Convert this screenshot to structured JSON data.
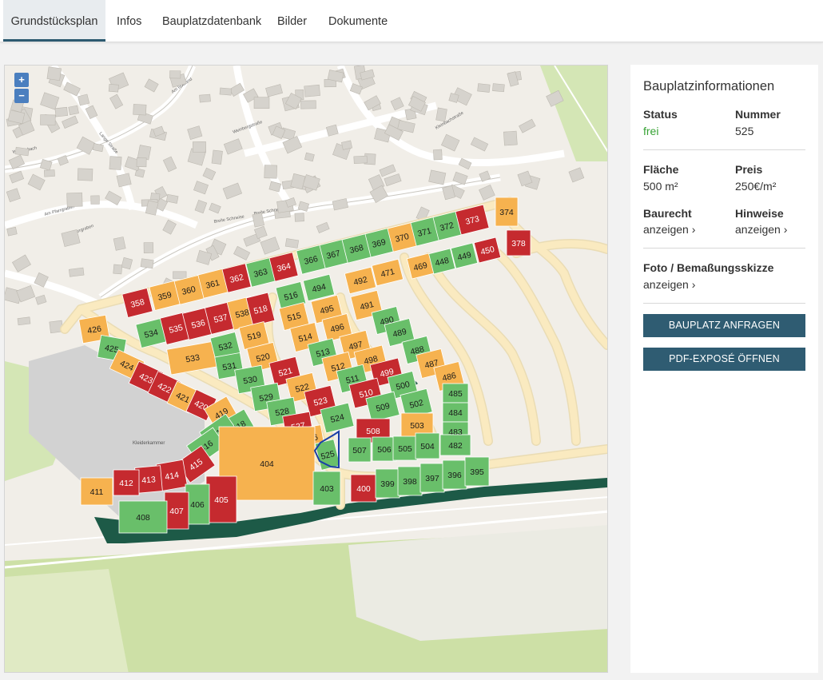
{
  "tabs": [
    {
      "label": "Grundstücksplan",
      "active": true
    },
    {
      "label": "Infos"
    },
    {
      "label": "Bauplatzdatenbank"
    },
    {
      "label": "Bilder"
    },
    {
      "label": "Dokumente"
    }
  ],
  "map": {
    "zoom_in": "+",
    "zoom_out": "−",
    "streets": [
      "Am Rodland",
      "Am Pfarrgraben",
      "Am Pfarrgraben",
      "Breite Schneise",
      "Breite Schneise",
      "Lange Straße",
      "Weißenbach",
      "Weinbergstraße",
      "Kleinbachstraße"
    ],
    "area_label": "Kleiderkammer"
  },
  "colors": {
    "free": "#69bf6a",
    "reserved": "#f6b24f",
    "sold": "#c52a2f",
    "road": "#faeac0",
    "green_strip": "#1d5a47",
    "selected_outline": "#1a3fa8"
  },
  "panel": {
    "title": "Bauplatzinformationen",
    "status_label": "Status",
    "status_value": "frei",
    "number_label": "Nummer",
    "number_value": "525",
    "area_label": "Fläche",
    "area_value": "500 m²",
    "price_label": "Preis",
    "price_value": "250€/m²",
    "baurecht_label": "Baurecht",
    "baurecht_link": "anzeigen ›",
    "hinweise_label": "Hinweise",
    "hinweise_link": "anzeigen ›",
    "foto_label": "Foto / Bemaßungsskizze",
    "foto_link": "anzeigen ›",
    "request_button": "BAUPLATZ ANFRAGEN",
    "pdf_button": "PDF-EXPOSÉ ÖFFNEN"
  },
  "plots": [
    {
      "num": "374",
      "s": "r"
    },
    {
      "num": "373",
      "s": "s"
    },
    {
      "num": "372",
      "s": "f"
    },
    {
      "num": "371",
      "s": "f"
    },
    {
      "num": "370",
      "s": "r"
    },
    {
      "num": "369",
      "s": "f"
    },
    {
      "num": "368",
      "s": "f"
    },
    {
      "num": "367",
      "s": "f"
    },
    {
      "num": "366",
      "s": "f"
    },
    {
      "num": "364",
      "s": "s"
    },
    {
      "num": "363",
      "s": "f"
    },
    {
      "num": "362",
      "s": "s"
    },
    {
      "num": "361",
      "s": "r"
    },
    {
      "num": "360",
      "s": "r"
    },
    {
      "num": "359",
      "s": "r"
    },
    {
      "num": "358",
      "s": "s"
    },
    {
      "num": "378",
      "s": "s"
    },
    {
      "num": "450",
      "s": "s"
    },
    {
      "num": "449",
      "s": "f"
    },
    {
      "num": "448",
      "s": "f"
    },
    {
      "num": "469",
      "s": "r"
    },
    {
      "num": "471",
      "s": "r"
    },
    {
      "num": "492",
      "s": "r"
    },
    {
      "num": "494",
      "s": "f"
    },
    {
      "num": "516",
      "s": "f"
    },
    {
      "num": "426",
      "s": "r"
    },
    {
      "num": "534",
      "s": "f"
    },
    {
      "num": "535",
      "s": "s"
    },
    {
      "num": "536",
      "s": "s"
    },
    {
      "num": "537",
      "s": "s"
    },
    {
      "num": "538",
      "s": "r"
    },
    {
      "num": "518",
      "s": "s"
    },
    {
      "num": "515",
      "s": "r"
    },
    {
      "num": "495",
      "s": "r"
    },
    {
      "num": "491",
      "s": "r"
    },
    {
      "num": "425",
      "s": "f"
    },
    {
      "num": "533",
      "s": "r"
    },
    {
      "num": "532",
      "s": "f"
    },
    {
      "num": "519",
      "s": "r"
    },
    {
      "num": "514",
      "s": "r"
    },
    {
      "num": "496",
      "s": "r"
    },
    {
      "num": "490",
      "s": "f"
    },
    {
      "num": "489",
      "s": "f"
    },
    {
      "num": "424",
      "s": "r"
    },
    {
      "num": "531",
      "s": "f"
    },
    {
      "num": "520",
      "s": "r"
    },
    {
      "num": "513",
      "s": "f"
    },
    {
      "num": "497",
      "s": "r"
    },
    {
      "num": "488",
      "s": "f"
    },
    {
      "num": "498",
      "s": "r"
    },
    {
      "num": "487",
      "s": "r"
    },
    {
      "num": "423",
      "s": "s"
    },
    {
      "num": "422",
      "s": "s"
    },
    {
      "num": "530",
      "s": "f"
    },
    {
      "num": "521",
      "s": "s"
    },
    {
      "num": "512",
      "s": "r"
    },
    {
      "num": "511",
      "s": "f"
    },
    {
      "num": "499",
      "s": "s"
    },
    {
      "num": "486",
      "s": "r"
    },
    {
      "num": "421",
      "s": "r"
    },
    {
      "num": "420",
      "s": "s"
    },
    {
      "num": "529",
      "s": "f"
    },
    {
      "num": "522",
      "s": "r"
    },
    {
      "num": "510",
      "s": "s"
    },
    {
      "num": "500",
      "s": "f"
    },
    {
      "num": "485",
      "s": "f"
    },
    {
      "num": "419",
      "s": "r"
    },
    {
      "num": "528",
      "s": "f"
    },
    {
      "num": "523",
      "s": "s"
    },
    {
      "num": "509",
      "s": "f"
    },
    {
      "num": "502",
      "s": "f"
    },
    {
      "num": "484",
      "s": "f"
    },
    {
      "num": "418",
      "s": "f"
    },
    {
      "num": "527",
      "s": "s"
    },
    {
      "num": "524",
      "s": "f"
    },
    {
      "num": "503",
      "s": "r"
    },
    {
      "num": "483",
      "s": "f"
    },
    {
      "num": "508",
      "s": "s"
    },
    {
      "num": "417",
      "s": "f"
    },
    {
      "num": "526",
      "s": "r"
    },
    {
      "num": "525",
      "s": "f"
    },
    {
      "num": "507",
      "s": "f"
    },
    {
      "num": "506",
      "s": "f"
    },
    {
      "num": "505",
      "s": "f"
    },
    {
      "num": "504",
      "s": "f"
    },
    {
      "num": "482",
      "s": "f"
    },
    {
      "num": "416",
      "s": "f"
    },
    {
      "num": "415",
      "s": "s"
    },
    {
      "num": "414",
      "s": "s"
    },
    {
      "num": "413",
      "s": "s"
    },
    {
      "num": "412",
      "s": "s"
    },
    {
      "num": "411",
      "s": "r"
    },
    {
      "num": "404",
      "s": "r"
    },
    {
      "num": "403",
      "s": "f"
    },
    {
      "num": "400",
      "s": "s"
    },
    {
      "num": "399",
      "s": "f"
    },
    {
      "num": "398",
      "s": "f"
    },
    {
      "num": "397",
      "s": "f"
    },
    {
      "num": "396",
      "s": "f"
    },
    {
      "num": "395",
      "s": "f"
    },
    {
      "num": "405",
      "s": "s"
    },
    {
      "num": "406",
      "s": "f"
    },
    {
      "num": "407",
      "s": "s"
    },
    {
      "num": "408",
      "s": "f"
    }
  ]
}
